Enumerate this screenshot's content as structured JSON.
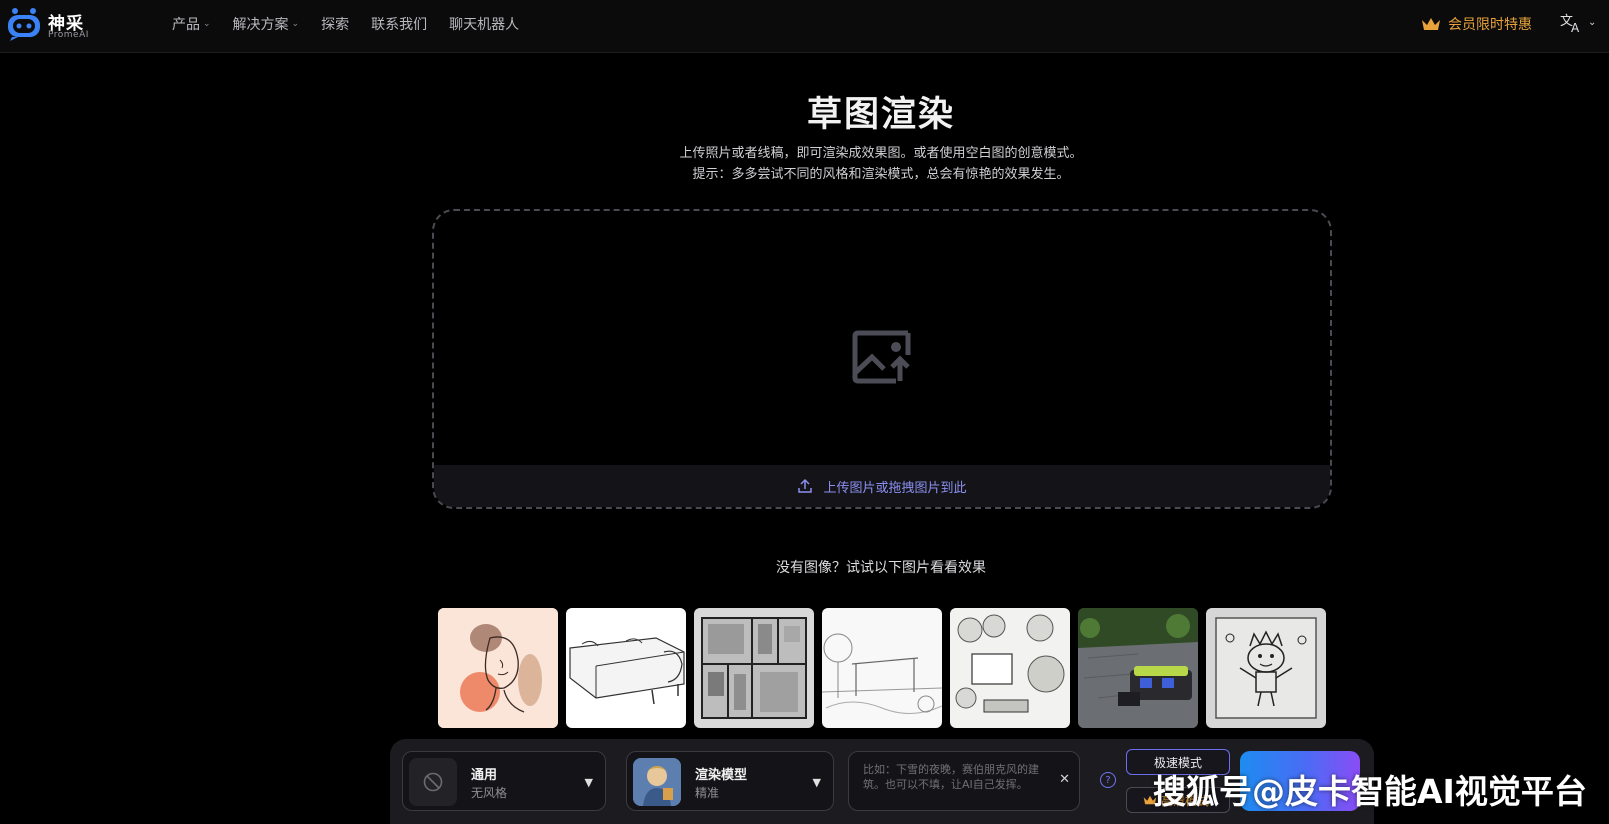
{
  "header": {
    "logo_name": "神采",
    "logo_sub": "PromeAI",
    "nav": [
      {
        "label": "产品",
        "has_dropdown": true
      },
      {
        "label": "解决方案",
        "has_dropdown": true
      },
      {
        "label": "探索",
        "has_dropdown": false
      },
      {
        "label": "联系我们",
        "has_dropdown": false
      },
      {
        "label": "聊天机器人",
        "has_dropdown": false
      }
    ],
    "vip_label": "会员限时特惠",
    "language_icon": "translate-icon"
  },
  "main": {
    "title": "草图渲染",
    "description_line1": "上传照片或者线稿，即可渲染成效果图。或者使用空白图的创意模式。",
    "description_line2": "提示：多多尝试不同的风格和渲染模式，总会有惊艳的效果发生。",
    "upload_label": "上传图片或拖拽图片到此",
    "try_samples_text": "没有图像？试试以下图片看看效果",
    "samples": [
      {
        "name": "line-art-woman"
      },
      {
        "name": "sofa-sketch"
      },
      {
        "name": "floor-plan-3d"
      },
      {
        "name": "garden-sketch"
      },
      {
        "name": "landscape-plan"
      },
      {
        "name": "patio-photo"
      },
      {
        "name": "child-drawing"
      }
    ]
  },
  "toolbar": {
    "style": {
      "label": "通用",
      "sub": "无风格"
    },
    "model": {
      "label": "渲染模型",
      "sub": "精准"
    },
    "prompt_placeholder": "比如：下雪的夜晚，赛伯朋克风的建筑。也可以不填，让AI自己发挥。",
    "help_label": "?",
    "mode_fast": "极速模式",
    "mode_hd": "高清模式"
  },
  "watermark": "搜狐号@皮卡智能AI视觉平台",
  "colors": {
    "accent": "#6f74f5",
    "vip": "#e8a33a",
    "background": "#000000"
  }
}
